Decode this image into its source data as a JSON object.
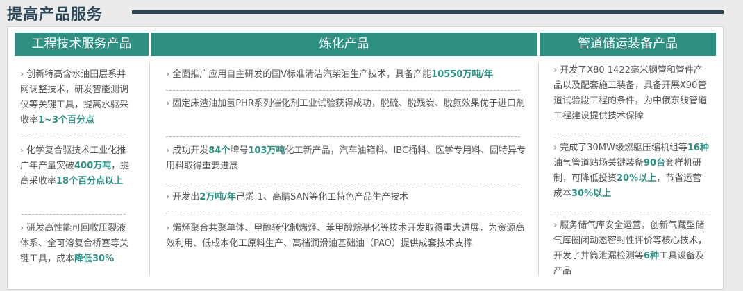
{
  "header": {
    "title": "提高产品服务"
  },
  "columns": [
    {
      "title": "工程技术服务产品",
      "items": [
        [
          {
            "t": "创新特高含水油田层系井网调整技术，研发智能测调仪等关键工具，提高水驱采收率"
          },
          {
            "t": "1~3个百分点",
            "b": true
          }
        ],
        [
          {
            "t": "化学复合驱技术工业化推广年产量突破"
          },
          {
            "t": "400万吨",
            "b": true
          },
          {
            "t": "，提高采收率"
          },
          {
            "t": "18个百分点以上",
            "b": true
          }
        ],
        [
          {
            "t": "研发高性能可回收压裂液体系、全可溶复合桥塞等关键工具，成本"
          },
          {
            "t": "降低30%",
            "b": true
          }
        ]
      ]
    },
    {
      "title": "炼化产品",
      "items": [
        [
          {
            "t": "全面推广应用自主研发的国Ⅴ标准清洁汽柴油生产技术，具备产能"
          },
          {
            "t": "10550万吨/年",
            "b": true
          }
        ],
        [
          {
            "t": "固定床渣油加氢PHR系列催化剂工业试验获得成功，脱硫、脱残炭、脱氮效果优于进口剂"
          }
        ],
        [
          {
            "t": "成功开发"
          },
          {
            "t": "84个",
            "b": true
          },
          {
            "t": "牌号"
          },
          {
            "t": "103万吨",
            "b": true
          },
          {
            "t": "化工新产品，汽车油箱料、IBC桶料、医学专用料、固特异专用料取得重要进展"
          }
        ],
        [
          {
            "t": "开发出"
          },
          {
            "t": "2万吨/年",
            "b": true
          },
          {
            "t": "己烯-1、高腈SAN等化工特色产品生产技术"
          }
        ],
        [
          {
            "t": "烯烃聚合共聚单体、甲醇转化制烯烃、苯甲醇烷基化等技术开发取得重大进展，为资源高效利用、低成本化工原料生产、高档润滑油基础油（PAO）提供成套技术支撑"
          }
        ]
      ]
    },
    {
      "title": "管道储运装备产品",
      "items": [
        [
          {
            "t": "开发了X80 1422毫米钢管和管件产品以及配套施工装备，具备开展X90管道试验段工程的条件，为中俄东线管道工程建设提供技术保障"
          }
        ],
        [
          {
            "t": "完成了30MW级燃驱压缩机组等"
          },
          {
            "t": "16种",
            "b": true
          },
          {
            "t": "油气管道站场关键装备"
          },
          {
            "t": "90台",
            "b": true
          },
          {
            "t": "套样机研制，可降低投资"
          },
          {
            "t": "20%以上",
            "b": true
          },
          {
            "t": "，节省运营成本"
          },
          {
            "t": "30%以上",
            "b": true
          }
        ],
        [
          {
            "t": "服务储气库安全运营，创新气藏型储气库圈闭动态密封性评价等核心技术，开发了井筒泄漏检测等"
          },
          {
            "t": "6种",
            "b": true
          },
          {
            "t": "工具设备及产品"
          }
        ]
      ]
    }
  ]
}
